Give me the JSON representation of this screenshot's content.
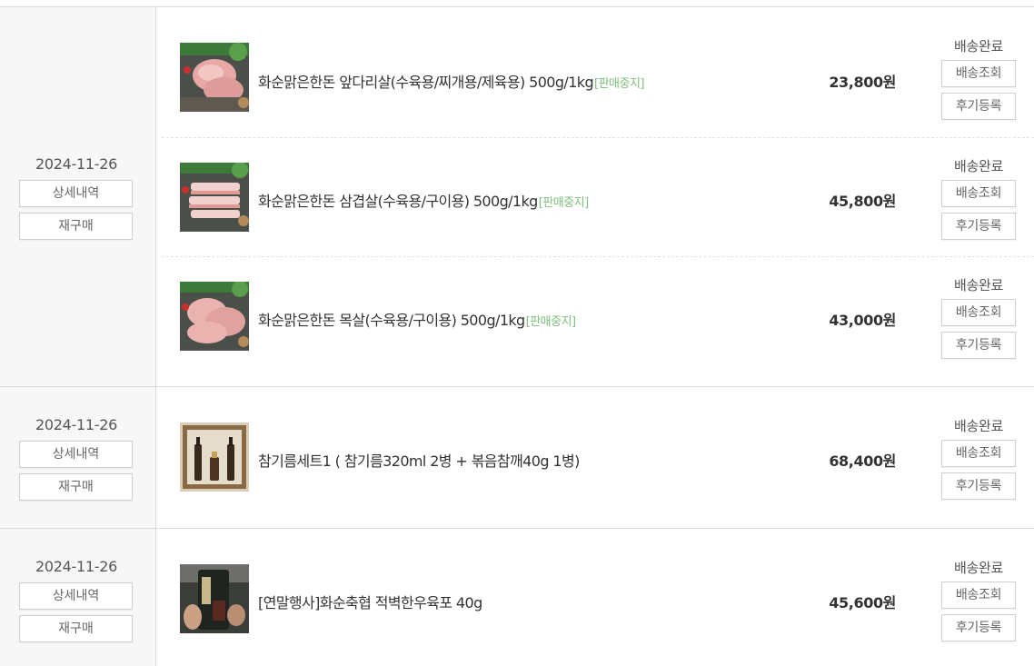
{
  "orders": [
    {
      "date": "2024-11-26",
      "detail_label": "상세내역",
      "reorder_label": "재구매",
      "items": [
        {
          "name": "화순맑은한돈 앞다리살(수육용/찌개용/제육용) 500g/1kg",
          "badge": "[판매중지]",
          "price": "23,800원",
          "status": "배송완료",
          "track_label": "배송조회",
          "review_label": "후기등록"
        },
        {
          "name": "화순맑은한돈 삼겹살(수육용/구이용) 500g/1kg",
          "badge": "[판매중지]",
          "price": "45,800원",
          "status": "배송완료",
          "track_label": "배송조회",
          "review_label": "후기등록"
        },
        {
          "name": "화순맑은한돈 목살(수육용/구이용) 500g/1kg",
          "badge": "[판매중지]",
          "price": "43,000원",
          "status": "배송완료",
          "track_label": "배송조회",
          "review_label": "후기등록"
        }
      ]
    },
    {
      "date": "2024-11-26",
      "detail_label": "상세내역",
      "reorder_label": "재구매",
      "items": [
        {
          "name": "참기름세트1 ( 참기름320ml 2병 + 볶음참깨40g 1병)",
          "price": "68,400원",
          "status": "배송완료",
          "track_label": "배송조회",
          "review_label": "후기등록"
        }
      ]
    },
    {
      "date": "2024-11-26",
      "detail_label": "상세내역",
      "reorder_label": "재구매",
      "items": [
        {
          "name": "[연말행사]화순축협 적벽한우육포 40g",
          "price": "45,600원",
          "status": "배송완료",
          "track_label": "배송조회",
          "review_label": "후기등록"
        }
      ]
    }
  ],
  "colors": {
    "border": "#dcdcdc",
    "left_bg": "#f7f7f7",
    "badge": "#7fbf7f"
  }
}
